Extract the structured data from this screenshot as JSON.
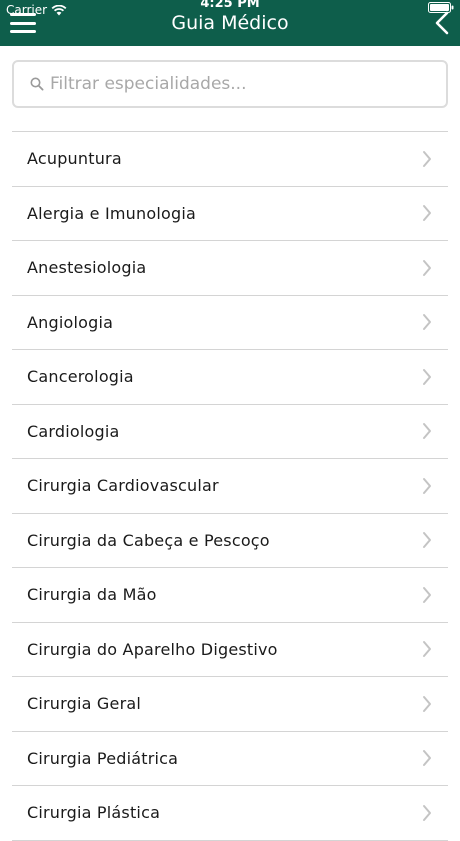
{
  "status_bar": {
    "carrier": "Carrier",
    "time": "4:25 PM"
  },
  "header": {
    "title": "Guia Médico",
    "menu_icon": "hamburger-menu-icon",
    "back_icon": "chevron-left-icon",
    "background_color": "#0e5e4b"
  },
  "search": {
    "placeholder": "Filtrar especialidades...",
    "value": "",
    "icon": "search-icon"
  },
  "specialties": [
    {
      "label": "Acupuntura"
    },
    {
      "label": "Alergia e Imunologia"
    },
    {
      "label": "Anestesiologia"
    },
    {
      "label": "Angiologia"
    },
    {
      "label": "Cancerologia"
    },
    {
      "label": "Cardiologia"
    },
    {
      "label": "Cirurgia Cardiovascular"
    },
    {
      "label": "Cirurgia da Cabeça e Pescoço"
    },
    {
      "label": "Cirurgia da Mão"
    },
    {
      "label": "Cirurgia do Aparelho Digestivo"
    },
    {
      "label": "Cirurgia Geral"
    },
    {
      "label": "Cirurgia Pediátrica"
    },
    {
      "label": "Cirurgia Plástica"
    }
  ]
}
